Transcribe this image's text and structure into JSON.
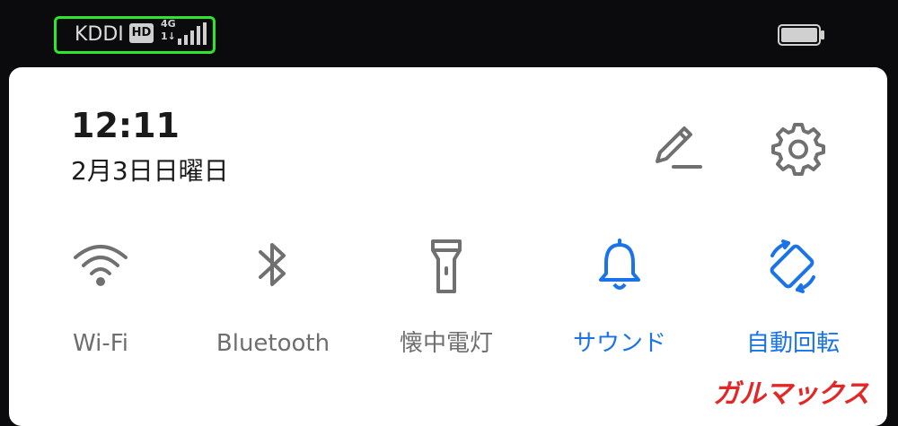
{
  "status_bar": {
    "carrier": "KDDI",
    "hd_badge": "HD",
    "network_type": "4G",
    "network_sub": "1↓",
    "signal_icon": "signal-bars-icon",
    "battery_icon": "battery-icon"
  },
  "panel": {
    "time": "12:11",
    "date": "2月3日日曜日",
    "edit_icon": "pencil-icon",
    "settings_icon": "gear-icon"
  },
  "tiles": [
    {
      "label": "Wi-Fi",
      "icon": "wifi-icon",
      "state": "off"
    },
    {
      "label": "Bluetooth",
      "icon": "bluetooth-icon",
      "state": "off"
    },
    {
      "label": "懐中電灯",
      "icon": "flashlight-icon",
      "state": "off"
    },
    {
      "label": "サウンド",
      "icon": "bell-icon",
      "state": "on"
    },
    {
      "label": "自動回転",
      "icon": "auto-rotate-icon",
      "state": "on"
    }
  ],
  "watermark": "ガルマックス",
  "colors": {
    "accent": "#1a73e8",
    "inactive": "#6e6e6e",
    "highlight_box": "#2ee62e",
    "watermark": "#e32727"
  }
}
